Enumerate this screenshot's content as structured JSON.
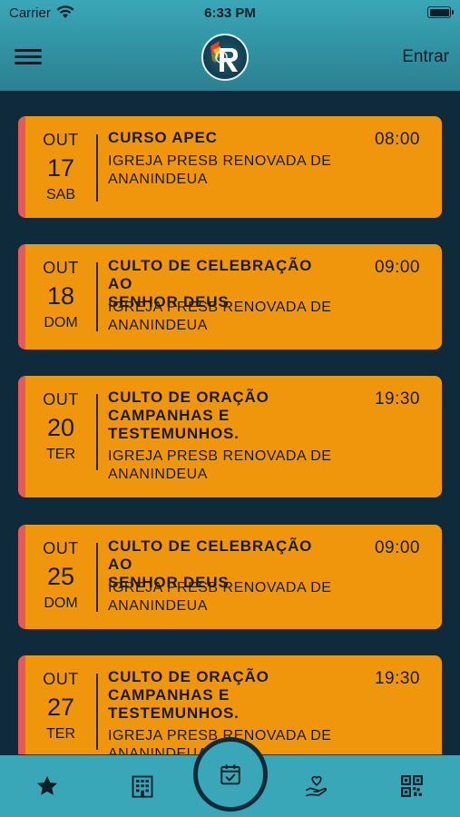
{
  "status": {
    "carrier": "Carrier",
    "time": "6:33 PM"
  },
  "header": {
    "login_label": "Entrar"
  },
  "events": [
    {
      "month": "OUT",
      "day": "17",
      "weekday": "SAB",
      "title_lines": [
        "CURSO APEC"
      ],
      "venue_lines": [
        "IGREJA PRESB RENOVADA DE",
        "ANANINDEUA"
      ],
      "time": "08:00"
    },
    {
      "month": "OUT",
      "day": "18",
      "weekday": "DOM",
      "title_lines": [
        "CULTO DE CELEBRAÇÃO AO",
        "SENHOR DEUS"
      ],
      "venue_lines": [
        "IGREJA PRESB RENOVADA DE",
        "ANANINDEUA"
      ],
      "time": "09:00"
    },
    {
      "month": "OUT",
      "day": "20",
      "weekday": "TER",
      "title_lines": [
        "CULTO DE ORAÇÃO",
        "CAMPANHAS E",
        "TESTEMUNHOS."
      ],
      "venue_lines": [
        "IGREJA PRESB RENOVADA DE",
        "ANANINDEUA"
      ],
      "time": "19:30"
    },
    {
      "month": "OUT",
      "day": "25",
      "weekday": "DOM",
      "title_lines": [
        "CULTO DE CELEBRAÇÃO AO",
        "SENHOR DEUS"
      ],
      "venue_lines": [
        "IGREJA PRESB RENOVADA DE",
        "ANANINDEUA"
      ],
      "time": "09:00"
    },
    {
      "month": "OUT",
      "day": "27",
      "weekday": "TER",
      "title_lines": [
        "CULTO DE ORAÇÃO",
        "CAMPANHAS E",
        "TESTEMUNHOS."
      ],
      "venue_lines": [
        "IGREJA PRESB RENOVADA DE",
        "ANANINDEUA"
      ],
      "time": "19:30"
    }
  ],
  "tabbar": {
    "tabs": [
      {
        "icon": "star-icon"
      },
      {
        "icon": "building-icon"
      },
      {
        "icon": "calendar-check-icon",
        "active": true
      },
      {
        "icon": "hand-heart-icon"
      },
      {
        "icon": "qr-code-icon"
      }
    ]
  },
  "colors": {
    "header": "#3aa7b8",
    "background": "#0e2a3b",
    "card": "#f0960c",
    "card_accent": "#e45a5a"
  }
}
